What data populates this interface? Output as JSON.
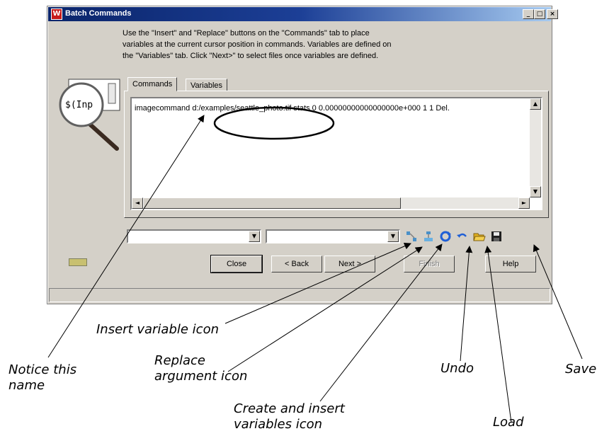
{
  "window": {
    "title": "Batch Commands",
    "minimize": "_",
    "maximize": "□",
    "close": "×"
  },
  "instructions": {
    "line1": "Use the \"Insert\" and \"Replace\" buttons on the \"Commands\" tab to place",
    "line2": "variables at the current cursor position in commands. Variables are defined on",
    "line3": "the \"Variables\" tab. Click \"Next>\" to select files once variables are defined."
  },
  "magnifier_text": "$(Inp",
  "tabs": [
    {
      "label": "Commands",
      "active": true
    },
    {
      "label": "Variables",
      "active": false
    }
  ],
  "command_text": "imagecommand d:/examples/seattle_photo.tif stats 0 0.00000000000000000e+000 1 1 Del.",
  "toolbar": {
    "combo1_value": "",
    "combo2_value": "",
    "icons": [
      "insert-variable",
      "replace-argument",
      "create-insert-variables",
      "undo",
      "load",
      "save"
    ]
  },
  "buttons": {
    "close": "Close",
    "back": "< Back",
    "next": "Next >",
    "finish": "Finish",
    "help": "Help"
  },
  "callouts": {
    "insert_variable": "Insert variable icon",
    "notice_line1": "Notice this",
    "notice_line2": "name",
    "replace_line1": "Replace",
    "replace_line2": "argument icon",
    "create_line1": "Create and insert",
    "create_line2": "variables icon",
    "undo": "Undo",
    "load": "Load",
    "save": "Save"
  },
  "colors": {
    "title_bar": "#0a246a",
    "face": "#d4d0c8",
    "accent_blue": "#1f5fd6",
    "load_yellow": "#e0b020"
  }
}
